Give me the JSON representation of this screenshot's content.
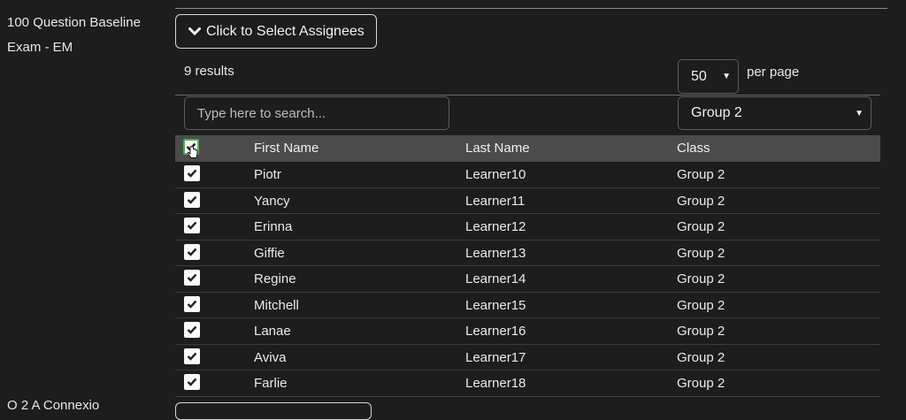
{
  "exam": {
    "title": "100 Question Baseline Exam - EM"
  },
  "assign_button": {
    "label": "Click to Select Assignees",
    "icon": "chevron-down-icon"
  },
  "results": {
    "count_text": "9 results"
  },
  "per_page": {
    "value": "50",
    "label": "per page"
  },
  "search": {
    "placeholder": "Type here to search..."
  },
  "class_filter": {
    "value": "Group 2"
  },
  "table": {
    "headers": {
      "first": "First Name",
      "last": "Last Name",
      "class": "Class"
    },
    "rows": [
      {
        "first": "Piotr",
        "last": "Learner10",
        "class": "Group 2",
        "checked": true
      },
      {
        "first": "Yancy",
        "last": "Learner11",
        "class": "Group 2",
        "checked": true
      },
      {
        "first": "Erinna",
        "last": "Learner12",
        "class": "Group 2",
        "checked": true
      },
      {
        "first": "Giffie",
        "last": "Learner13",
        "class": "Group 2",
        "checked": true
      },
      {
        "first": "Regine",
        "last": "Learner14",
        "class": "Group 2",
        "checked": true
      },
      {
        "first": "Mitchell",
        "last": "Learner15",
        "class": "Group 2",
        "checked": true
      },
      {
        "first": "Lanae",
        "last": "Learner16",
        "class": "Group 2",
        "checked": true
      },
      {
        "first": "Aviva",
        "last": "Learner17",
        "class": "Group 2",
        "checked": true
      },
      {
        "first": "Farlie",
        "last": "Learner18",
        "class": "Group 2",
        "checked": true
      }
    ]
  },
  "next_item": {
    "title": "O 2 A Connexio"
  },
  "colors": {
    "background": "#1d1d1d",
    "header_row": "#4b4b4b",
    "select_all_focus": "#4caf50"
  }
}
